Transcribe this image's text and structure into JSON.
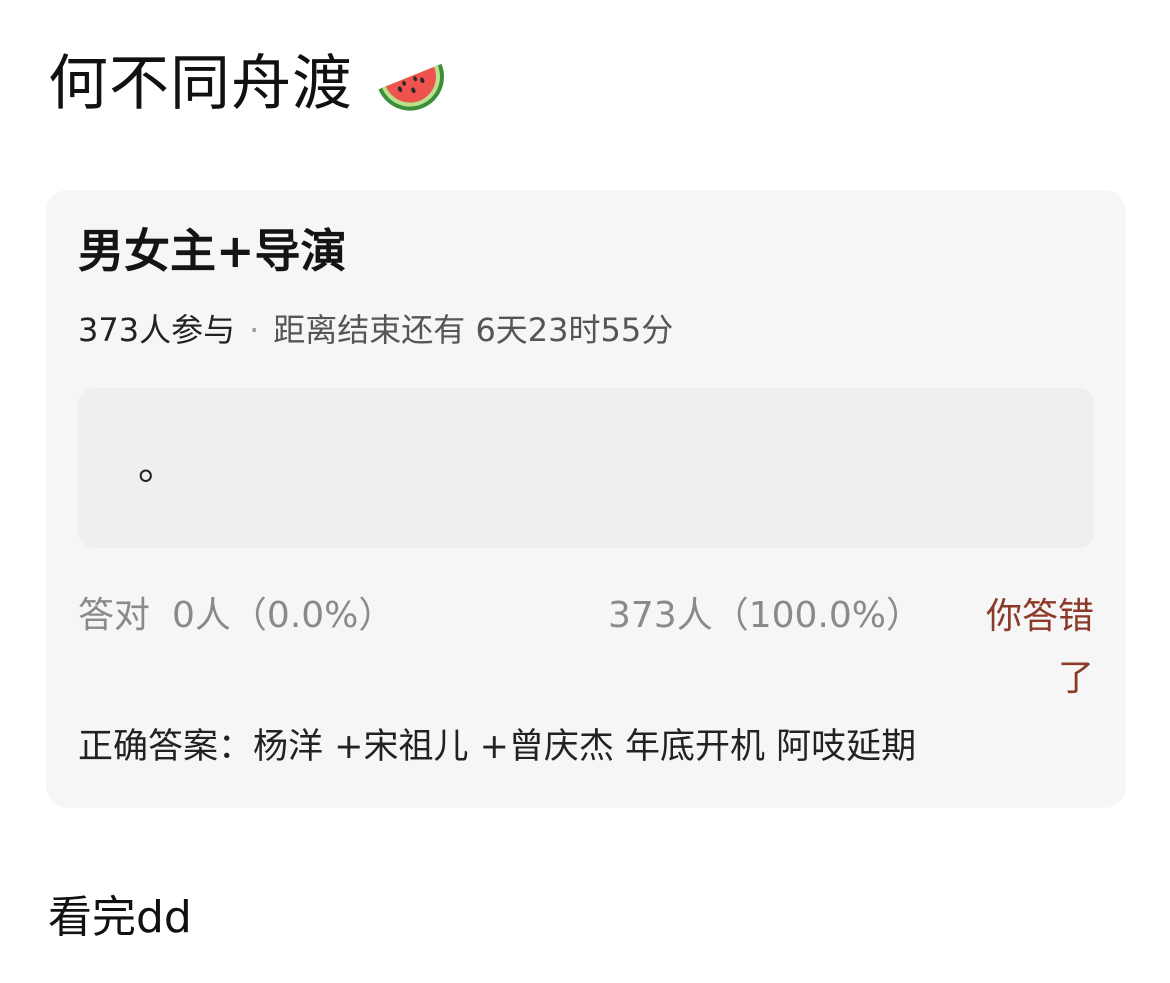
{
  "post": {
    "title": "何不同舟渡",
    "title_emoji": "watermelon-icon",
    "comment": "看完dd"
  },
  "quiz": {
    "title": "男女主+导演",
    "participants": "373人参与",
    "separator": "·",
    "countdown": "距离结束还有 6天23时55分",
    "answer_text": "。",
    "correct_label": "答对",
    "correct_stat": "0人（0.0%）",
    "wrong_stat": "373人（100.0%）",
    "result": "你答错了",
    "correct_answer": "正确答案：杨洋 +宋祖儿 +曾庆杰 年底开机 阿吱延期"
  },
  "colors": {
    "background": "#ffffff",
    "card": "#f6f6f6",
    "answer_box": "#efefef",
    "result_text": "#8b3a2a",
    "muted_text": "#8a8a8a"
  }
}
